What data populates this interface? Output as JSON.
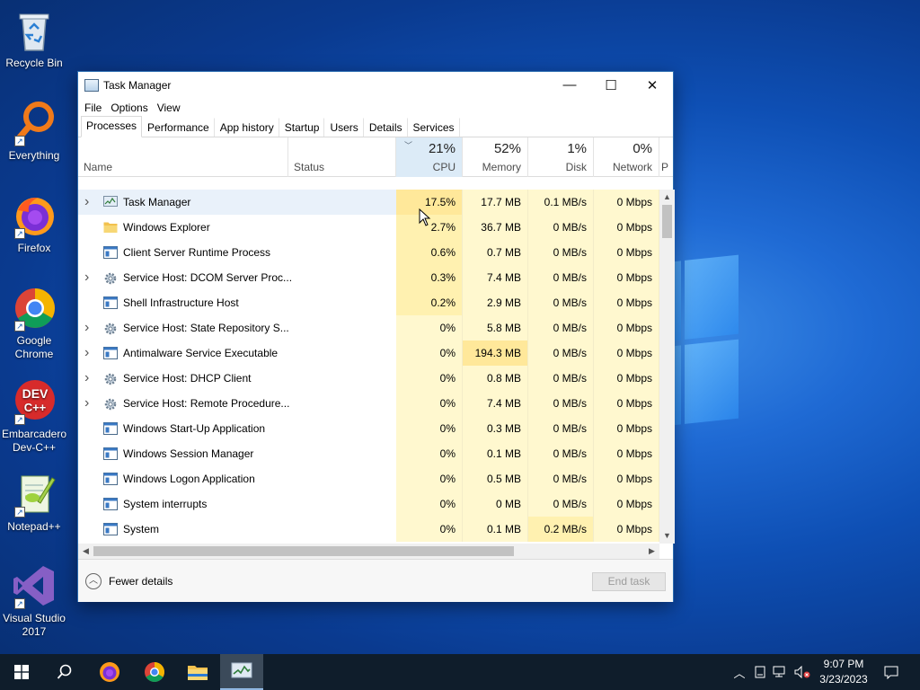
{
  "desktop": {
    "icons": [
      {
        "label": "Recycle Bin",
        "icon": "recycle-bin-icon"
      },
      {
        "label": "Everything",
        "icon": "everything-search-icon"
      },
      {
        "label": "Firefox",
        "icon": "firefox-icon"
      },
      {
        "label": "Google Chrome",
        "icon": "chrome-icon"
      },
      {
        "label": "Embarcadero Dev-C++",
        "icon": "devcpp-icon",
        "badge": "DEV C++"
      },
      {
        "label": "Notepad++",
        "icon": "notepadpp-icon"
      },
      {
        "label": "Visual Studio 2017",
        "icon": "visual-studio-icon"
      }
    ]
  },
  "window": {
    "title": "Task Manager",
    "controls": {
      "minimize": "—",
      "maximize": "☐",
      "close": "✕"
    },
    "menu": [
      "File",
      "Options",
      "View"
    ],
    "tabs": [
      "Processes",
      "Performance",
      "App history",
      "Startup",
      "Users",
      "Details",
      "Services"
    ],
    "active_tab": "Processes",
    "columns": {
      "name": "Name",
      "status": "Status",
      "cpu": {
        "pct": "21%",
        "label": "CPU"
      },
      "memory": {
        "pct": "52%",
        "label": "Memory"
      },
      "disk": {
        "pct": "1%",
        "label": "Disk"
      },
      "network": {
        "pct": "0%",
        "label": "Network"
      },
      "power": "P"
    },
    "processes": [
      {
        "name": "Task Manager",
        "expand": true,
        "icon": "task-manager-icon",
        "cpu": "17.5%",
        "memory": "17.7 MB",
        "disk": "0.1 MB/s",
        "network": "0 Mbps",
        "cpu_heat": 3,
        "mem_heat": 1,
        "disk_heat": 1
      },
      {
        "name": "Windows Explorer",
        "expand": false,
        "icon": "folder-icon",
        "cpu": "2.7%",
        "memory": "36.7 MB",
        "disk": "0 MB/s",
        "network": "0 Mbps",
        "cpu_heat": 2,
        "mem_heat": 1,
        "disk_heat": 1
      },
      {
        "name": "Client Server Runtime Process",
        "expand": false,
        "icon": "window-app-icon",
        "cpu": "0.6%",
        "memory": "0.7 MB",
        "disk": "0 MB/s",
        "network": "0 Mbps",
        "cpu_heat": 2,
        "mem_heat": 1,
        "disk_heat": 1
      },
      {
        "name": "Service Host: DCOM Server Proc...",
        "expand": true,
        "icon": "gear-icon",
        "cpu": "0.3%",
        "memory": "7.4 MB",
        "disk": "0 MB/s",
        "network": "0 Mbps",
        "cpu_heat": 2,
        "mem_heat": 1,
        "disk_heat": 1
      },
      {
        "name": "Shell Infrastructure Host",
        "expand": false,
        "icon": "window-app-icon",
        "cpu": "0.2%",
        "memory": "2.9 MB",
        "disk": "0 MB/s",
        "network": "0 Mbps",
        "cpu_heat": 2,
        "mem_heat": 1,
        "disk_heat": 1
      },
      {
        "name": "Service Host: State Repository S...",
        "expand": true,
        "icon": "gear-icon",
        "cpu": "0%",
        "memory": "5.8 MB",
        "disk": "0 MB/s",
        "network": "0 Mbps",
        "cpu_heat": 1,
        "mem_heat": 1,
        "disk_heat": 1
      },
      {
        "name": "Antimalware Service Executable",
        "expand": true,
        "icon": "window-app-icon",
        "cpu": "0%",
        "memory": "194.3 MB",
        "disk": "0 MB/s",
        "network": "0 Mbps",
        "cpu_heat": 1,
        "mem_heat": 3,
        "disk_heat": 1
      },
      {
        "name": "Service Host: DHCP Client",
        "expand": true,
        "icon": "gear-icon",
        "cpu": "0%",
        "memory": "0.8 MB",
        "disk": "0 MB/s",
        "network": "0 Mbps",
        "cpu_heat": 1,
        "mem_heat": 1,
        "disk_heat": 1
      },
      {
        "name": "Service Host: Remote Procedure...",
        "expand": true,
        "icon": "gear-icon",
        "cpu": "0%",
        "memory": "7.4 MB",
        "disk": "0 MB/s",
        "network": "0 Mbps",
        "cpu_heat": 1,
        "mem_heat": 1,
        "disk_heat": 1
      },
      {
        "name": "Windows Start-Up Application",
        "expand": false,
        "icon": "window-app-icon",
        "cpu": "0%",
        "memory": "0.3 MB",
        "disk": "0 MB/s",
        "network": "0 Mbps",
        "cpu_heat": 1,
        "mem_heat": 1,
        "disk_heat": 1
      },
      {
        "name": "Windows Session Manager",
        "expand": false,
        "icon": "window-app-icon",
        "cpu": "0%",
        "memory": "0.1 MB",
        "disk": "0 MB/s",
        "network": "0 Mbps",
        "cpu_heat": 1,
        "mem_heat": 1,
        "disk_heat": 1
      },
      {
        "name": "Windows Logon Application",
        "expand": false,
        "icon": "window-app-icon",
        "cpu": "0%",
        "memory": "0.5 MB",
        "disk": "0 MB/s",
        "network": "0 Mbps",
        "cpu_heat": 1,
        "mem_heat": 1,
        "disk_heat": 1
      },
      {
        "name": "System interrupts",
        "expand": false,
        "icon": "window-app-icon",
        "cpu": "0%",
        "memory": "0 MB",
        "disk": "0 MB/s",
        "network": "0 Mbps",
        "cpu_heat": 1,
        "mem_heat": 1,
        "disk_heat": 1
      },
      {
        "name": "System",
        "expand": false,
        "icon": "window-app-icon",
        "cpu": "0%",
        "memory": "0.1 MB",
        "disk": "0.2 MB/s",
        "network": "0 Mbps",
        "cpu_heat": 1,
        "mem_heat": 1,
        "disk_heat": 2
      }
    ],
    "footer": {
      "fewer_details": "Fewer details",
      "end_task": "End task"
    }
  },
  "taskbar": {
    "apps": [
      "start-icon",
      "search-icon",
      "firefox-icon",
      "chrome-icon",
      "file-explorer-icon",
      "task-manager-icon"
    ],
    "active_app": "task-manager-icon",
    "tray": {
      "time": "9:07 PM",
      "date": "3/23/2023"
    }
  },
  "colors": {
    "heat1": "#fff8cf",
    "heat2": "#fff1b0",
    "heat3": "#ffe89a",
    "selected_row": "#e9f1fa",
    "taskbar": "#0f1d2b"
  }
}
